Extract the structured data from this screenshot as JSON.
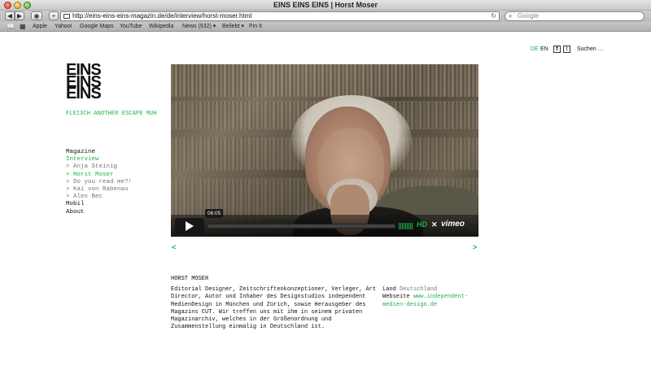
{
  "browser": {
    "window_title": "EINS EINS EINS | Horst Moser",
    "url": "http://eins-eins-eins-magazin.de/de/interview/horst-moser.html",
    "search_placeholder": "Google",
    "bookmarks": [
      "Apple",
      "Yahoo!",
      "Google Maps",
      "YouTube",
      "Wikipedia",
      "News (932) ▾",
      "Beliebt ▾",
      "Pin It"
    ]
  },
  "site": {
    "logo_lines": [
      "EINS",
      "EINS",
      "EINS"
    ],
    "tagline": "FLEISCH ANOTHER ESCAPE MUH",
    "nav": [
      {
        "label": "Magazine",
        "state": "dark"
      },
      {
        "label": "Interview",
        "state": "active"
      },
      {
        "label": "> Anja Steinig",
        "state": "sub"
      },
      {
        "label": "> Horst Moser",
        "state": "active"
      },
      {
        "label": "> Do you read me?!",
        "state": "sub"
      },
      {
        "label": "> Kai von Rabenau",
        "state": "sub"
      },
      {
        "label": "> Alex Bec",
        "state": "sub"
      },
      {
        "label": "Mobil",
        "state": "dark"
      },
      {
        "label": "About",
        "state": "dark"
      }
    ],
    "lang": {
      "de": "DE",
      "en": "EN",
      "search": "Suchen …"
    },
    "accent_color": "#1ab24a"
  },
  "video": {
    "timestamp": "06:05",
    "hd_label": "HD",
    "provider": "vimeo"
  },
  "pager": {
    "prev": "<",
    "next": ">"
  },
  "article": {
    "title": "HORST MOSER",
    "body_lines": [
      "Editorial Designer, Zeitschriftenkonzeptioner, Verleger, Art",
      "Director, Autor und Inhaber des Designstudios independent",
      "MedienDesign in München und Zürich, sowie Herausgeber des",
      "Magazins CUT. Wir treffen uns mit ihm in seinem privaten",
      "Magazinarchiv, welches in der Größenordnung und",
      "Zusammenstellung einmalig in Deutschland ist."
    ],
    "meta": {
      "land_label": "Land",
      "land_value": "Deutschland",
      "website_label": "Webseite",
      "website_value_line1": "www.independent-",
      "website_value_line2": "medien-design.de"
    }
  }
}
